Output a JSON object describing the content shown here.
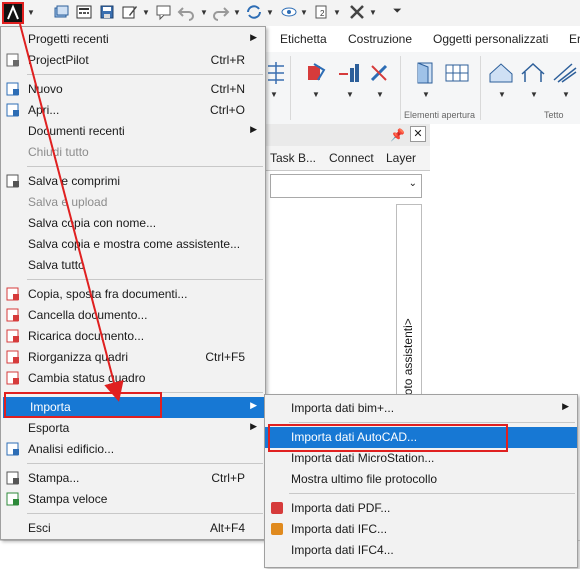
{
  "ribbon": {
    "tabs": [
      "Etichetta",
      "Costruzione",
      "Oggetti personalizzati",
      "Er"
    ],
    "groups": [
      "Elementi apertura",
      "Tetto"
    ]
  },
  "palette": {
    "tabs": [
      "Task B...",
      "Connect",
      "Layer"
    ],
    "vertical_label": "<Elenco vuoto assistenti>"
  },
  "menu": {
    "items": [
      {
        "label": "Progetti recenti",
        "shortcut": "",
        "submenu": true,
        "disabled": false
      },
      {
        "label": "ProjectPilot",
        "shortcut": "Ctrl+R",
        "submenu": false,
        "disabled": false
      },
      {
        "label": "Nuovo",
        "shortcut": "Ctrl+N",
        "submenu": false,
        "disabled": false
      },
      {
        "label": "Apri...",
        "shortcut": "Ctrl+O",
        "submenu": false,
        "disabled": false
      },
      {
        "label": "Documenti recenti",
        "shortcut": "",
        "submenu": true,
        "disabled": false
      },
      {
        "label": "Chiudi tutto",
        "shortcut": "",
        "submenu": false,
        "disabled": true
      },
      {
        "label": "Salva e comprimi",
        "shortcut": "",
        "submenu": false,
        "disabled": false
      },
      {
        "label": "Salva e upload",
        "shortcut": "",
        "submenu": false,
        "disabled": true
      },
      {
        "label": "Salva copia con nome...",
        "shortcut": "",
        "submenu": false,
        "disabled": false
      },
      {
        "label": "Salva copia e mostra come assistente...",
        "shortcut": "",
        "submenu": false,
        "disabled": false
      },
      {
        "label": "Salva tutto",
        "shortcut": "",
        "submenu": false,
        "disabled": false
      },
      {
        "label": "Copia, sposta fra documenti...",
        "shortcut": "",
        "submenu": false,
        "disabled": false
      },
      {
        "label": "Cancella documento...",
        "shortcut": "",
        "submenu": false,
        "disabled": false
      },
      {
        "label": "Ricarica documento...",
        "shortcut": "",
        "submenu": false,
        "disabled": false
      },
      {
        "label": "Riorganizza quadri",
        "shortcut": "Ctrl+F5",
        "submenu": false,
        "disabled": false
      },
      {
        "label": "Cambia status quadro",
        "shortcut": "",
        "submenu": false,
        "disabled": false
      },
      {
        "label": "Importa",
        "shortcut": "",
        "submenu": true,
        "disabled": false
      },
      {
        "label": "Esporta",
        "shortcut": "",
        "submenu": true,
        "disabled": false
      },
      {
        "label": "Analisi edificio...",
        "shortcut": "",
        "submenu": false,
        "disabled": false
      },
      {
        "label": "Stampa...",
        "shortcut": "Ctrl+P",
        "submenu": false,
        "disabled": false
      },
      {
        "label": "Stampa veloce",
        "shortcut": "",
        "submenu": false,
        "disabled": false
      },
      {
        "label": "Esci",
        "shortcut": "Alt+F4",
        "submenu": false,
        "disabled": false
      }
    ]
  },
  "submenu": {
    "items": [
      {
        "label": "Importa dati bim+...",
        "submenu": true
      },
      {
        "label": "Importa dati AutoCAD...",
        "submenu": false
      },
      {
        "label": "Importa dati MicroStation...",
        "submenu": false
      },
      {
        "label": "Mostra ultimo file protocollo",
        "submenu": false
      },
      {
        "label": "Importa dati PDF...",
        "submenu": false
      },
      {
        "label": "Importa dati IFC...",
        "submenu": false
      },
      {
        "label": "Importa dati IFC4...",
        "submenu": false
      }
    ]
  },
  "glyphs": {
    "submenu_arrow": "▶",
    "dropdown": "▼",
    "close": "✕"
  },
  "colors": {
    "highlight": "#1778d4",
    "annotation_red": "#e02020"
  }
}
